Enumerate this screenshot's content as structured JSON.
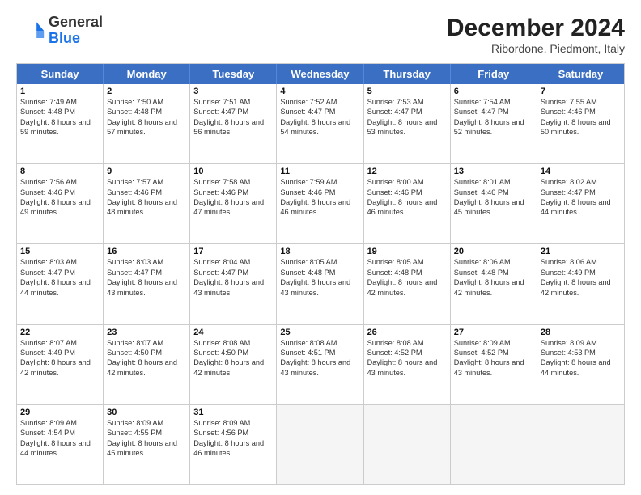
{
  "header": {
    "logo_line1": "General",
    "logo_line2": "Blue",
    "title": "December 2024",
    "subtitle": "Ribordone, Piedmont, Italy"
  },
  "days": [
    "Sunday",
    "Monday",
    "Tuesday",
    "Wednesday",
    "Thursday",
    "Friday",
    "Saturday"
  ],
  "rows": [
    [
      {
        "day": "1",
        "sunrise": "7:49 AM",
        "sunset": "4:48 PM",
        "daylight": "8 hours and 59 minutes."
      },
      {
        "day": "2",
        "sunrise": "7:50 AM",
        "sunset": "4:48 PM",
        "daylight": "8 hours and 57 minutes."
      },
      {
        "day": "3",
        "sunrise": "7:51 AM",
        "sunset": "4:47 PM",
        "daylight": "8 hours and 56 minutes."
      },
      {
        "day": "4",
        "sunrise": "7:52 AM",
        "sunset": "4:47 PM",
        "daylight": "8 hours and 54 minutes."
      },
      {
        "day": "5",
        "sunrise": "7:53 AM",
        "sunset": "4:47 PM",
        "daylight": "8 hours and 53 minutes."
      },
      {
        "day": "6",
        "sunrise": "7:54 AM",
        "sunset": "4:47 PM",
        "daylight": "8 hours and 52 minutes."
      },
      {
        "day": "7",
        "sunrise": "7:55 AM",
        "sunset": "4:46 PM",
        "daylight": "8 hours and 50 minutes."
      }
    ],
    [
      {
        "day": "8",
        "sunrise": "7:56 AM",
        "sunset": "4:46 PM",
        "daylight": "8 hours and 49 minutes."
      },
      {
        "day": "9",
        "sunrise": "7:57 AM",
        "sunset": "4:46 PM",
        "daylight": "8 hours and 48 minutes."
      },
      {
        "day": "10",
        "sunrise": "7:58 AM",
        "sunset": "4:46 PM",
        "daylight": "8 hours and 47 minutes."
      },
      {
        "day": "11",
        "sunrise": "7:59 AM",
        "sunset": "4:46 PM",
        "daylight": "8 hours and 46 minutes."
      },
      {
        "day": "12",
        "sunrise": "8:00 AM",
        "sunset": "4:46 PM",
        "daylight": "8 hours and 46 minutes."
      },
      {
        "day": "13",
        "sunrise": "8:01 AM",
        "sunset": "4:46 PM",
        "daylight": "8 hours and 45 minutes."
      },
      {
        "day": "14",
        "sunrise": "8:02 AM",
        "sunset": "4:47 PM",
        "daylight": "8 hours and 44 minutes."
      }
    ],
    [
      {
        "day": "15",
        "sunrise": "8:03 AM",
        "sunset": "4:47 PM",
        "daylight": "8 hours and 44 minutes."
      },
      {
        "day": "16",
        "sunrise": "8:03 AM",
        "sunset": "4:47 PM",
        "daylight": "8 hours and 43 minutes."
      },
      {
        "day": "17",
        "sunrise": "8:04 AM",
        "sunset": "4:47 PM",
        "daylight": "8 hours and 43 minutes."
      },
      {
        "day": "18",
        "sunrise": "8:05 AM",
        "sunset": "4:48 PM",
        "daylight": "8 hours and 43 minutes."
      },
      {
        "day": "19",
        "sunrise": "8:05 AM",
        "sunset": "4:48 PM",
        "daylight": "8 hours and 42 minutes."
      },
      {
        "day": "20",
        "sunrise": "8:06 AM",
        "sunset": "4:48 PM",
        "daylight": "8 hours and 42 minutes."
      },
      {
        "day": "21",
        "sunrise": "8:06 AM",
        "sunset": "4:49 PM",
        "daylight": "8 hours and 42 minutes."
      }
    ],
    [
      {
        "day": "22",
        "sunrise": "8:07 AM",
        "sunset": "4:49 PM",
        "daylight": "8 hours and 42 minutes."
      },
      {
        "day": "23",
        "sunrise": "8:07 AM",
        "sunset": "4:50 PM",
        "daylight": "8 hours and 42 minutes."
      },
      {
        "day": "24",
        "sunrise": "8:08 AM",
        "sunset": "4:50 PM",
        "daylight": "8 hours and 42 minutes."
      },
      {
        "day": "25",
        "sunrise": "8:08 AM",
        "sunset": "4:51 PM",
        "daylight": "8 hours and 43 minutes."
      },
      {
        "day": "26",
        "sunrise": "8:08 AM",
        "sunset": "4:52 PM",
        "daylight": "8 hours and 43 minutes."
      },
      {
        "day": "27",
        "sunrise": "8:09 AM",
        "sunset": "4:52 PM",
        "daylight": "8 hours and 43 minutes."
      },
      {
        "day": "28",
        "sunrise": "8:09 AM",
        "sunset": "4:53 PM",
        "daylight": "8 hours and 44 minutes."
      }
    ],
    [
      {
        "day": "29",
        "sunrise": "8:09 AM",
        "sunset": "4:54 PM",
        "daylight": "8 hours and 44 minutes."
      },
      {
        "day": "30",
        "sunrise": "8:09 AM",
        "sunset": "4:55 PM",
        "daylight": "8 hours and 45 minutes."
      },
      {
        "day": "31",
        "sunrise": "8:09 AM",
        "sunset": "4:56 PM",
        "daylight": "8 hours and 46 minutes."
      },
      null,
      null,
      null,
      null
    ]
  ]
}
